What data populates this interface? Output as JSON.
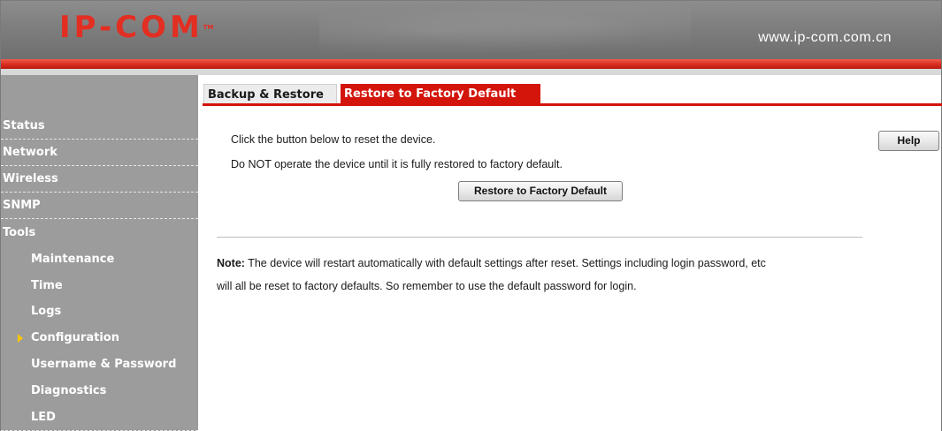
{
  "header": {
    "logo": "IP-COM",
    "logo_tm": "TM",
    "url": "www.ip-com.com.cn"
  },
  "sidebar": {
    "items": [
      {
        "label": "Status",
        "level": "top"
      },
      {
        "label": "Network",
        "level": "top"
      },
      {
        "label": "Wireless",
        "level": "top"
      },
      {
        "label": "SNMP",
        "level": "top"
      },
      {
        "label": "Tools",
        "level": "top"
      },
      {
        "label": "Maintenance",
        "level": "sub"
      },
      {
        "label": "Time",
        "level": "sub"
      },
      {
        "label": "Logs",
        "level": "sub"
      },
      {
        "label": "Configuration",
        "level": "sub",
        "selected": true
      },
      {
        "label": "Username & Password",
        "level": "sub"
      },
      {
        "label": "Diagnostics",
        "level": "sub"
      },
      {
        "label": "LED",
        "level": "sub"
      }
    ]
  },
  "tabs": [
    {
      "label": "Backup & Restore",
      "active": false
    },
    {
      "label": "Restore to Factory Default",
      "active": true
    }
  ],
  "content": {
    "line1": "Click the button below to reset the device.",
    "line2": "Do NOT operate the device until it is fully restored to factory default.",
    "restore_button": "Restore to Factory Default",
    "help_button": "Help",
    "note_label": "Note:",
    "note_line1": "The device will restart automatically with default settings after reset. Settings including login password, etc",
    "note_line2": "will all be reset to factory defaults. So remember to use the default password for login."
  },
  "colors": {
    "brand_red": "#d3150b",
    "sidebar_bg": "#9c9c9c",
    "header_gray": "#7b7b7b",
    "selected_arrow": "#f5c400"
  }
}
